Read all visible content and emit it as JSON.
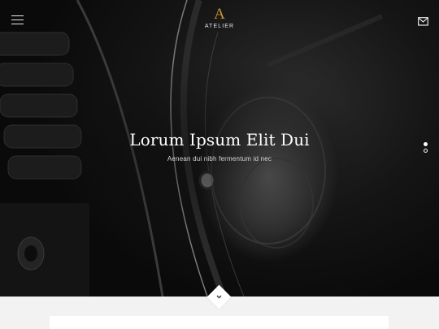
{
  "header": {
    "menu_icon": "hamburger-icon",
    "logo_mark": "A",
    "logo_text": "ATELIER",
    "mail_icon": "envelope-icon",
    "accent_color": "#c9962e"
  },
  "hero": {
    "title": "Lorum Ipsum Elit Dui",
    "subtitle": "Aenean dui nibh fermentum id nec",
    "slides_total": 2,
    "active_slide": 1
  },
  "scroll_icon": "chevron-down-icon"
}
